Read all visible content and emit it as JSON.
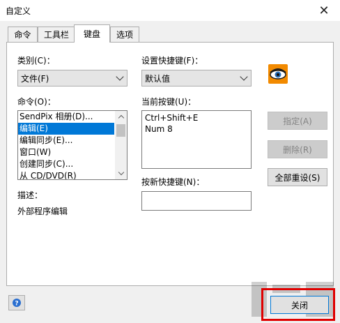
{
  "window": {
    "title": "自定义"
  },
  "tabs": [
    {
      "label": "命令",
      "active": false
    },
    {
      "label": "工具栏",
      "active": false
    },
    {
      "label": "键盘",
      "active": true
    },
    {
      "label": "选项",
      "active": false
    }
  ],
  "category": {
    "label": "类别(C)：",
    "value": "文件(F)"
  },
  "set_shortcut": {
    "label": "设置快捷键(F)：",
    "value": "默认值"
  },
  "commands": {
    "label": "命令(O)：",
    "items": [
      "SendPix 相册(D)...",
      "编辑(E)",
      "编辑同步(E)...",
      "窗口(W)",
      "创建同步(C)...",
      "从 CD/DVD(R)"
    ],
    "selected_index": 1
  },
  "current_keys": {
    "label": "当前按键(U)：",
    "lines": [
      "Ctrl+Shift+E",
      "Num 8"
    ]
  },
  "new_shortcut": {
    "label": "按新快捷键(N)：",
    "value": ""
  },
  "description": {
    "label": "描述：",
    "text": "外部程序编辑"
  },
  "buttons": {
    "assign": "指定(A)",
    "remove": "删除(R)",
    "reset_all": "全部重设(S)",
    "close": "关闭"
  },
  "colors": {
    "selection": "#0078d7",
    "highlight_border": "#e00000",
    "app_icon": "#f28a00"
  },
  "icons": {
    "app": "eye-icon",
    "help": "help-icon",
    "close": "close-icon"
  }
}
